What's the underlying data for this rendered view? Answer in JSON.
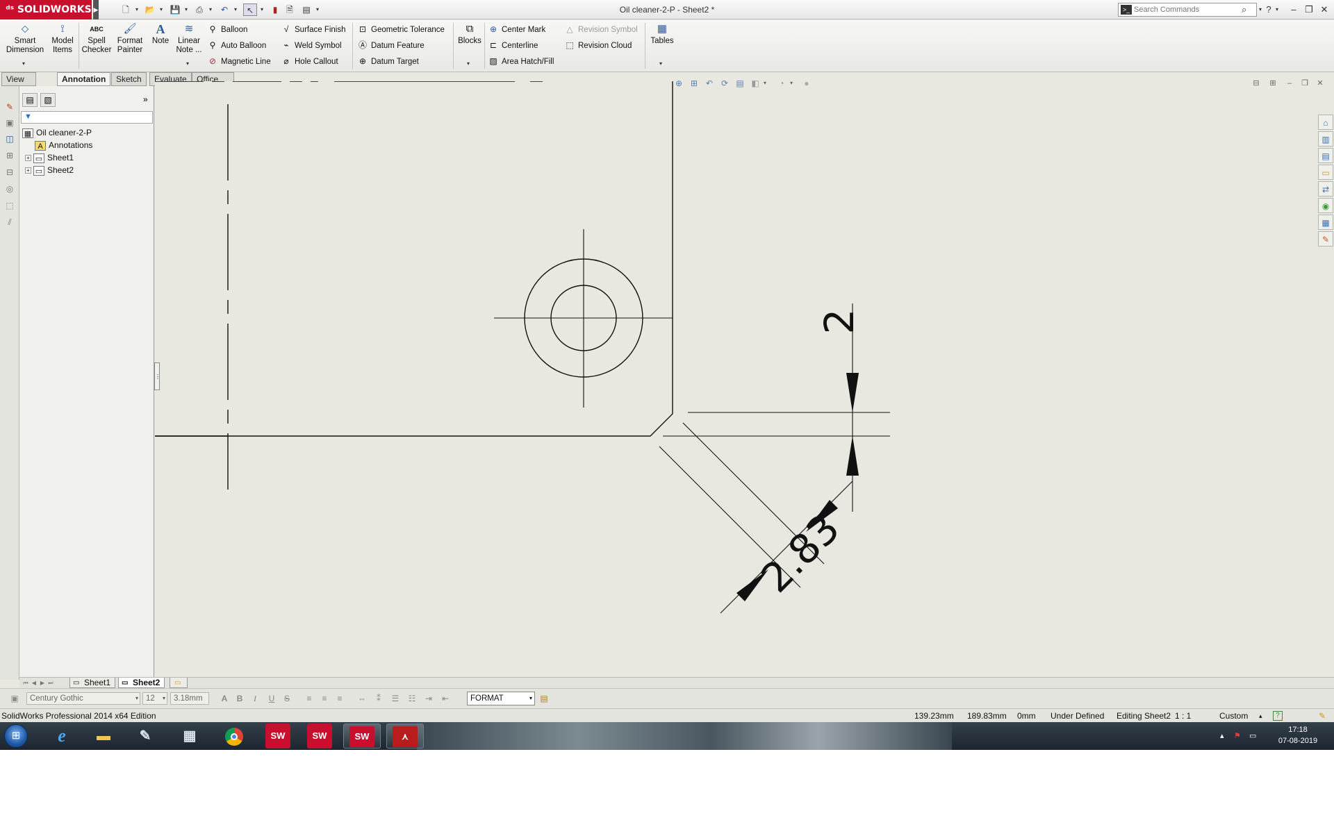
{
  "app": {
    "logo_text": "SOLIDWORKS",
    "doc_title": "Oil cleaner-2-P - Sheet2 *",
    "search_placeholder": "Search Commands",
    "brand_color": "#c8102e"
  },
  "ribbon": {
    "smart_dimension": [
      "Smart",
      "Dimension"
    ],
    "model_items": [
      "Model",
      "Items"
    ],
    "spell_checker": [
      "Spell",
      "Checker"
    ],
    "format_painter": [
      "Format",
      "Painter"
    ],
    "note": "Note",
    "linear_note": [
      "Linear",
      "Note ..."
    ],
    "balloon": "Balloon",
    "auto_balloon": "Auto Balloon",
    "magnetic_line": "Magnetic Line",
    "surface_finish": "Surface Finish",
    "weld_symbol": "Weld Symbol",
    "hole_callout": "Hole Callout",
    "geometric_tolerance": "Geometric Tolerance",
    "datum_feature": "Datum Feature",
    "datum_target": "Datum Target",
    "blocks": "Blocks",
    "center_mark": "Center Mark",
    "centerline": "Centerline",
    "area_hatch": "Area Hatch/Fill",
    "revision_symbol": "Revision Symbol",
    "revision_cloud": "Revision Cloud",
    "tables": "Tables"
  },
  "tabs": [
    "View Layout",
    "Annotation",
    "Sketch",
    "Evaluate",
    "Office Products"
  ],
  "active_tab": "Annotation",
  "tree": {
    "root": "Oil cleaner-2-P",
    "items": [
      "Annotations",
      "Sheet1",
      "Sheet2"
    ]
  },
  "drawing": {
    "dim_vertical": "2",
    "dim_chamfer": "2.83"
  },
  "sheet_tabs": [
    "Sheet1",
    "Sheet2"
  ],
  "active_sheet": "Sheet2",
  "format_toolbar": {
    "font": "Century Gothic",
    "size": "12",
    "height": "3.18mm",
    "layer": "FORMAT"
  },
  "status": {
    "edition": "SolidWorks Professional 2014 x64 Edition",
    "x": "139.23mm",
    "y": "189.83mm",
    "z": "0mm",
    "state": "Under Defined",
    "editing": "Editing Sheet2",
    "scale": "1 : 1",
    "units": "Custom"
  },
  "taskbar": {
    "time": "17:18",
    "date": "07-08-2019",
    "apps": [
      "internet-explorer",
      "file-explorer",
      "paint",
      "calculator",
      "chrome",
      "solidworks",
      "solidworks",
      "solidworks",
      "acrobat"
    ]
  }
}
